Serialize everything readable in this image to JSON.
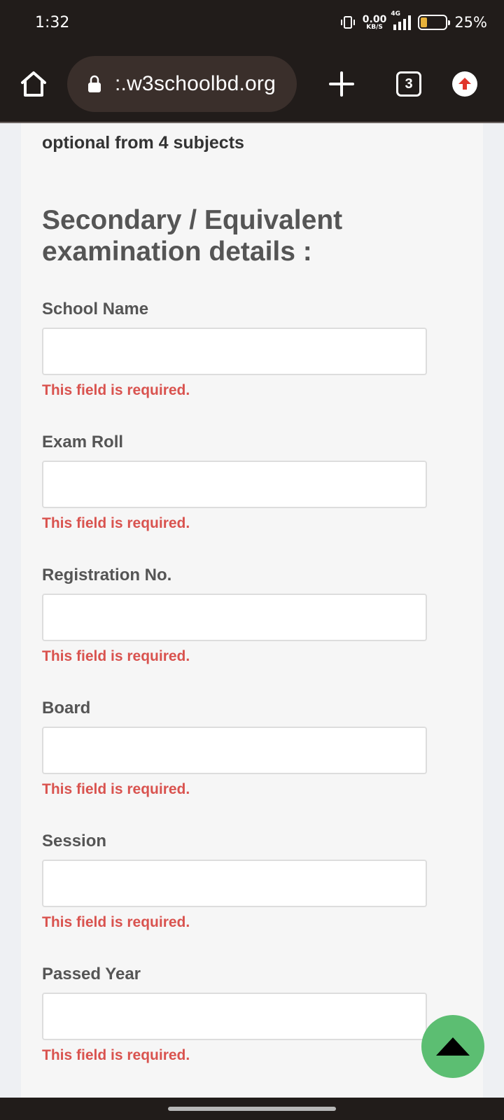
{
  "status_bar": {
    "time": "1:32",
    "net_speed_value": "0.00",
    "net_speed_unit": "KB/S",
    "network_type": "4G",
    "battery_percent": "25%",
    "battery_level": 0.25
  },
  "browser": {
    "url": ":.w3schoolbd.org",
    "tab_count": "3",
    "accent_update": "#e0352b"
  },
  "page": {
    "intro_text": "optional from 4 subjects",
    "section_title": "Secondary / Equivalent examination details :",
    "fields": [
      {
        "label": "School Name",
        "value": "",
        "error": "This field is required."
      },
      {
        "label": "Exam Roll",
        "value": "",
        "error": "This field is required."
      },
      {
        "label": "Registration No.",
        "value": "",
        "error": "This field is required."
      },
      {
        "label": "Board",
        "value": "",
        "error": "This field is required."
      },
      {
        "label": "Session",
        "value": "",
        "error": "This field is required."
      },
      {
        "label": "Passed Year",
        "value": "",
        "error": "This field is required."
      }
    ]
  },
  "colors": {
    "error": "#d9534f",
    "scroll_top_button": "#5cbe72",
    "chrome": "#211c1a"
  },
  "icons": {
    "home": "home-icon",
    "lock": "lock-icon",
    "new_tab": "plus-icon",
    "tabs": "tab-switcher-icon",
    "update": "arrow-up-icon",
    "scroll_top": "triangle-up-icon"
  }
}
